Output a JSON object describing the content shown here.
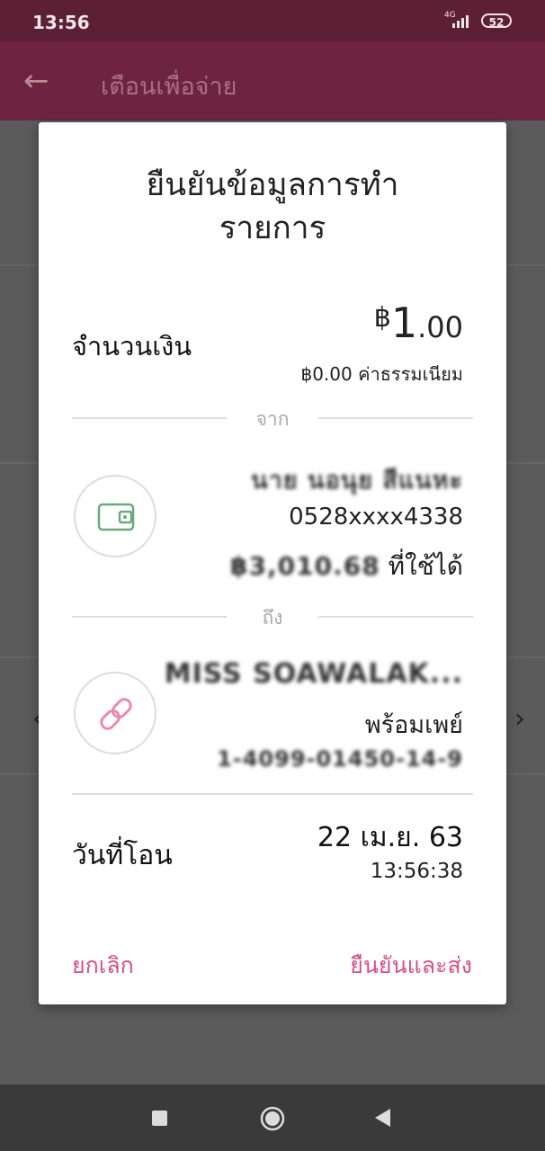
{
  "status_bar": {
    "time": "13:56",
    "network": "4G",
    "battery": "52"
  },
  "app_bar": {
    "title": "เตือนเพื่อจ่าย"
  },
  "dialog": {
    "title_line1": "ยืนยันข้อมูลการทำ",
    "title_line2": "รายการ",
    "amount_label": "จำนวนเงิน",
    "amount_currency": "฿",
    "amount_integer": "1",
    "amount_decimal": ".00",
    "fee_value": "฿0.00",
    "fee_label": "ค่าธรรมเนียม",
    "from_label": "จาก",
    "from": {
      "icon": "wallet-icon",
      "name": "นาย นอนุย สีแนหะ",
      "account": "0528xxxx4338",
      "balance_blurred": "฿3,010.68",
      "balance_suffix": "ที่ใช้ได้"
    },
    "to_label": "ถึง",
    "to": {
      "icon": "link-icon",
      "name": "MISS SOAWALAK...",
      "method": "พร้อมเพย์",
      "id_blurred": "1-4099-01450-14-9"
    },
    "date_label": "วันที่โอน",
    "date_value": "22 เม.ย. 63",
    "time_value": "13:56:38",
    "cancel_label": "ยกเลิก",
    "confirm_label": "ยืนยันและส่ง"
  },
  "colors": {
    "accent": "#d94d86",
    "status_bar": "#5c1f33",
    "app_bar": "#6e2440"
  }
}
